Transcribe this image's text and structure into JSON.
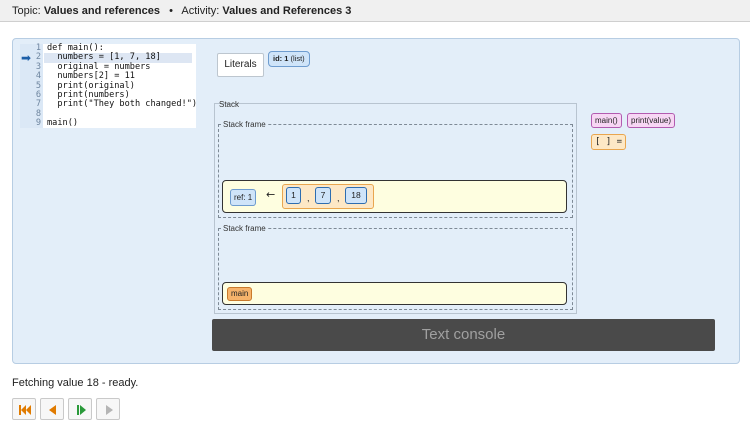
{
  "topbar": {
    "topic_label": "Topic:",
    "topic": "Values and references",
    "separator": "•",
    "activity_label": "Activity:",
    "activity": "Values and References 3"
  },
  "code": {
    "current_line": 2,
    "lines": [
      {
        "num": "1",
        "text": "def main():"
      },
      {
        "num": "2",
        "text": "  numbers = [1, 7, 18]"
      },
      {
        "num": "3",
        "text": "  original = numbers"
      },
      {
        "num": "4",
        "text": "  numbers[2] = 11"
      },
      {
        "num": "5",
        "text": "  print(original)"
      },
      {
        "num": "6",
        "text": "  print(numbers)"
      },
      {
        "num": "7",
        "text": "  print(\"They both changed!\")"
      },
      {
        "num": "8",
        "text": ""
      },
      {
        "num": "9",
        "text": "main()"
      }
    ]
  },
  "literals": {
    "label": "Literals",
    "id_label": "id: 1",
    "id_type": "(list)"
  },
  "stack": {
    "label": "Stack",
    "frame1_label": "Stack frame",
    "frame2_label": "Stack frame",
    "ref_label": "ref: 1",
    "arrow": "←",
    "list_values": [
      "1",
      "7",
      "18"
    ],
    "comma": ",",
    "main_label": "main"
  },
  "functions": {
    "main": "main()",
    "print": "print(value)",
    "list_literal": "[ ] ="
  },
  "console": {
    "label": "Text console"
  },
  "status": {
    "text": "Fetching value 18 - ready."
  },
  "controls": {
    "accent": "#e07b00",
    "play_accent": "#2a9a3a",
    "disabled": "#b5b5b5"
  }
}
